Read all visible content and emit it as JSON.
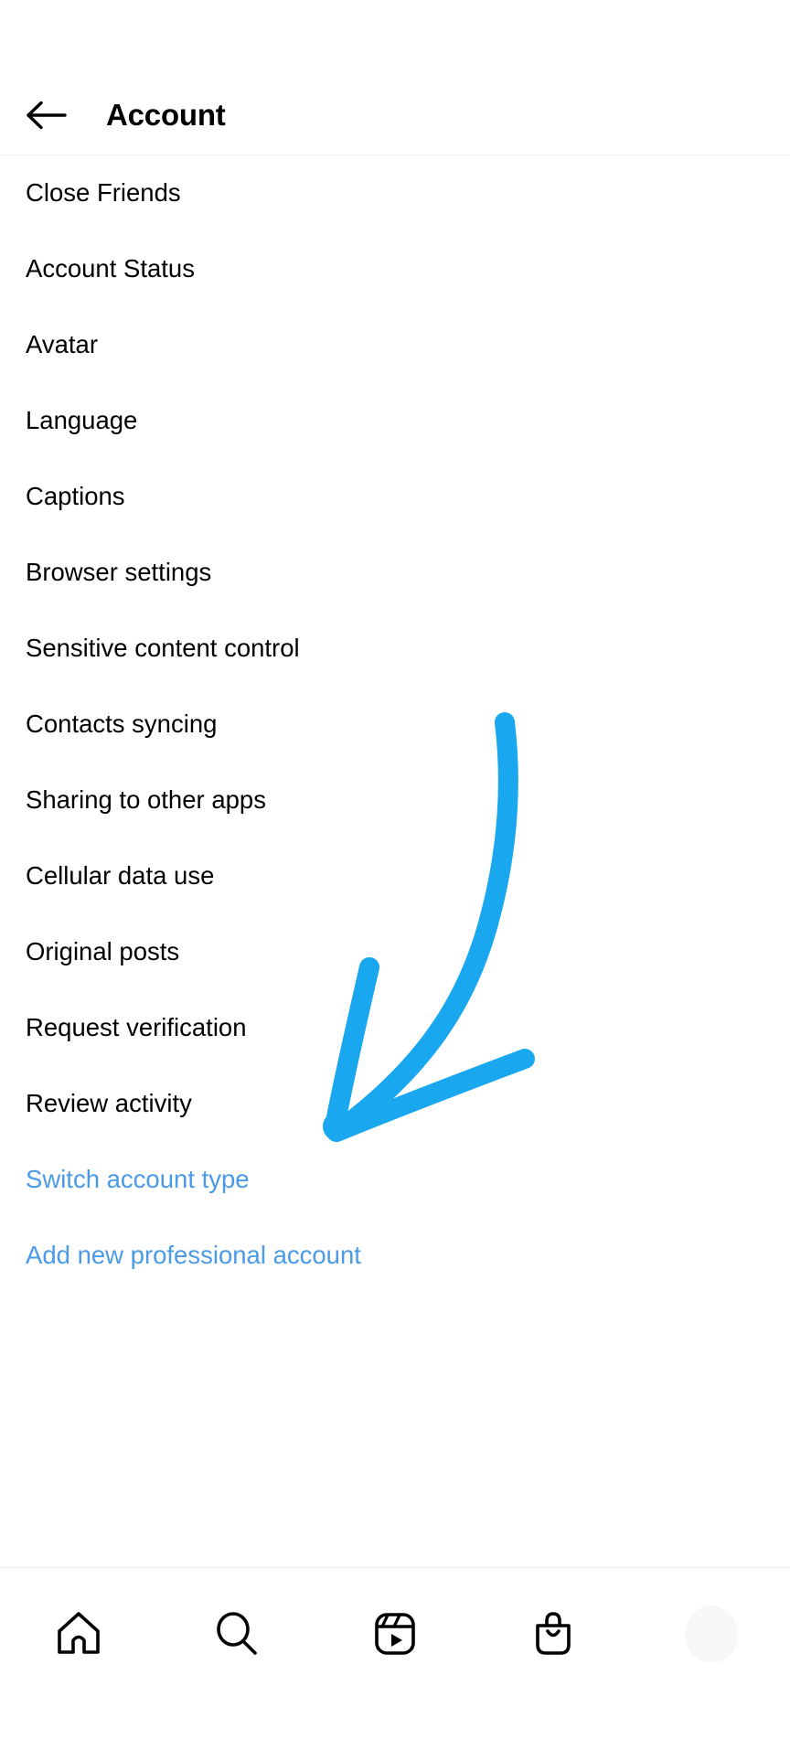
{
  "header": {
    "back_icon": "arrow-left-icon",
    "title": "Account"
  },
  "settings_list": [
    {
      "label": "Close Friends",
      "type": "normal"
    },
    {
      "label": "Account Status",
      "type": "normal"
    },
    {
      "label": "Avatar",
      "type": "normal"
    },
    {
      "label": "Language",
      "type": "normal"
    },
    {
      "label": "Captions",
      "type": "normal"
    },
    {
      "label": "Browser settings",
      "type": "normal"
    },
    {
      "label": "Sensitive content control",
      "type": "normal"
    },
    {
      "label": "Contacts syncing",
      "type": "normal"
    },
    {
      "label": "Sharing to other apps",
      "type": "normal"
    },
    {
      "label": "Cellular data use",
      "type": "normal"
    },
    {
      "label": "Original posts",
      "type": "normal"
    },
    {
      "label": "Request verification",
      "type": "normal"
    },
    {
      "label": "Review activity",
      "type": "normal"
    },
    {
      "label": "Switch account type",
      "type": "link"
    },
    {
      "label": "Add new professional account",
      "type": "link"
    }
  ],
  "bottom_nav": [
    {
      "icon": "home-icon",
      "name": "nav-home"
    },
    {
      "icon": "search-icon",
      "name": "nav-search"
    },
    {
      "icon": "reels-icon",
      "name": "nav-reels"
    },
    {
      "icon": "shop-bag-icon",
      "name": "nav-shop"
    },
    {
      "icon": "profile-avatar-icon",
      "name": "nav-profile"
    }
  ],
  "annotation": {
    "type": "hand-drawn-arrow",
    "color": "#19A7F0",
    "points_to": "Switch account type"
  },
  "colors": {
    "text_primary": "#000000",
    "link_blue": "#4a9ae8",
    "annotation_blue": "#19A7F0",
    "divider": "#efefef",
    "background": "#ffffff"
  }
}
